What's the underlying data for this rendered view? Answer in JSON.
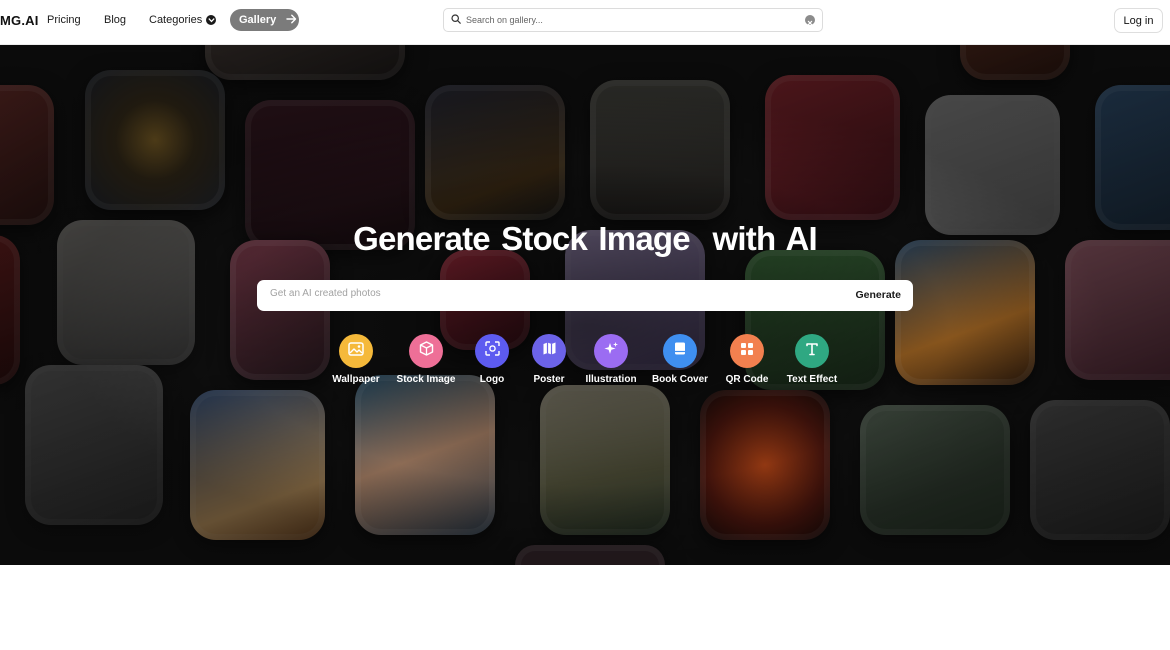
{
  "header": {
    "brand": "MG.AI",
    "nav": {
      "pricing": "Pricing",
      "blog": "Blog",
      "categories": "Categories"
    },
    "gallery_label": "Gallery",
    "search_placeholder": "Search on gallery...",
    "login_label": "Log in"
  },
  "hero": {
    "title": "Generate Stock Image  with AI",
    "prompt_placeholder": "Get an AI created photos",
    "generate_label": "Generate"
  },
  "categories": [
    {
      "label": "Wallpaper",
      "icon": "image-icon",
      "color": "#f5b93a"
    },
    {
      "label": "Stock Image",
      "icon": "cube-icon",
      "color": "#ee6f97"
    },
    {
      "label": "Logo",
      "icon": "focus-icon",
      "color": "#5d5bf0"
    },
    {
      "label": "Poster",
      "icon": "map-icon",
      "color": "#6c63e8"
    },
    {
      "label": "Illustration",
      "icon": "sparkle-icon",
      "color": "#9b6cf2"
    },
    {
      "label": "Book Cover",
      "icon": "book-icon",
      "color": "#3f8ff0"
    },
    {
      "label": "QR Code",
      "icon": "grid-icon",
      "color": "#f2804f"
    },
    {
      "label": "Text Effect",
      "icon": "letter-t-icon",
      "color": "#2fa882"
    }
  ],
  "colors": {
    "hero_background": "#141414",
    "gallery_button": "#7b7b7b",
    "text_primary": "#111111"
  }
}
